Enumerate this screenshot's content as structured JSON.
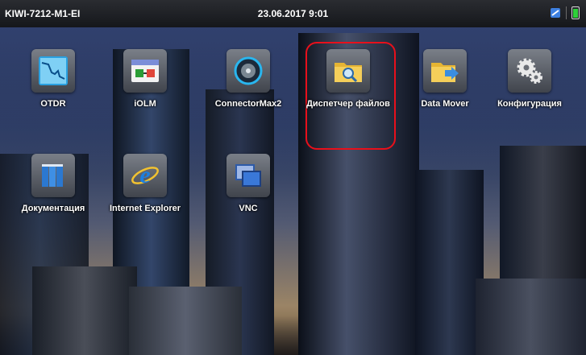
{
  "status_bar": {
    "device": "KIWI-7212-M1-EI",
    "datetime": "23.06.2017 9:01",
    "icons": [
      "network-icon",
      "battery-icon"
    ],
    "battery_color": "#2fd03a"
  },
  "apps": [
    {
      "label": "OTDR",
      "icon": "otdr-graph-icon"
    },
    {
      "label": "iOLM",
      "icon": "iolm-icon"
    },
    {
      "label": "ConnectorMax2",
      "icon": "connector-icon"
    },
    {
      "label": "Диспетчер файлов",
      "icon": "folder-search-icon"
    },
    {
      "label": "Data Mover",
      "icon": "folder-arrow-icon"
    },
    {
      "label": "Конфигурация",
      "icon": "gears-icon"
    },
    {
      "label": "Документация",
      "icon": "books-icon"
    },
    {
      "label": "Internet Explorer",
      "icon": "internet-explorer-icon"
    },
    {
      "label": "VNC",
      "icon": "vnc-windows-icon"
    }
  ],
  "highlight": {
    "target": "Диспетчер файлов",
    "color": "#e8101b"
  }
}
